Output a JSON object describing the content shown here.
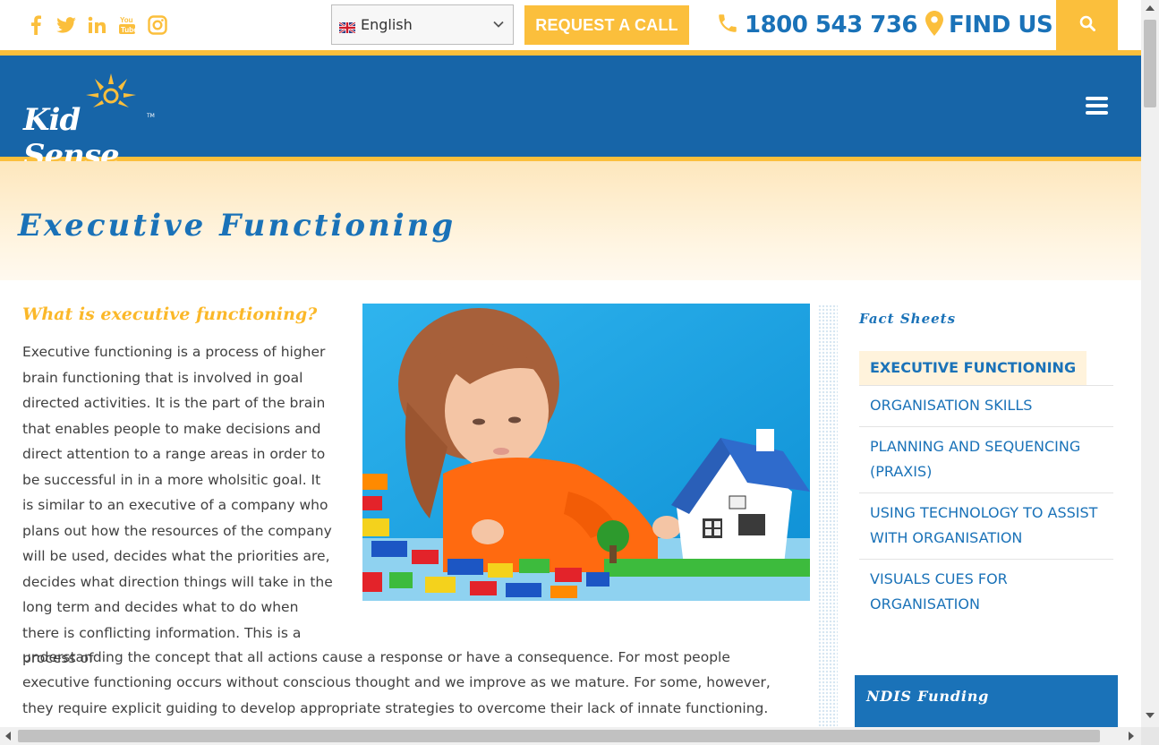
{
  "topbar": {
    "social_icons": [
      "facebook-icon",
      "twitter-icon",
      "linkedin-icon",
      "youtube-icon",
      "instagram-icon"
    ],
    "language": {
      "selected": "English",
      "flag": "uk-flag-icon"
    },
    "request_call_label": "REQUEST A CALL",
    "phone_label": "1800 543 736",
    "find_us_label": "FIND US"
  },
  "header": {
    "logo_text": "Kid Sense",
    "logo_tm": "TM"
  },
  "page": {
    "title": "Executive Functioning"
  },
  "content": {
    "heading": "What is executive functioning?",
    "paragraph_part1": "Executive functioning is a process of higher brain functioning that is involved in goal directed activities. It is the part of the brain that enables people to make decisions and direct attention to a range areas in order to be successful in in a  more wholsitic goal. It is similar to an executive of a company who plans out how the resources of the company will be used, decides what the priorities are, decides what direction things will take in the long term and decides what to do when there is conflicting information. This is a process of",
    "paragraph_part2": "understanding the concept that all actions cause a response or have a consequence. For most people executive functioning occurs without conscious thought and we improve as we mature. For some, however, they require explicit guiding to develop appropriate strategies to overcome their lack of innate functioning. Executive functioning deficits"
  },
  "sidebar": {
    "heading": "Fact Sheets",
    "items": [
      {
        "label": "EXECUTIVE FUNCTIONING",
        "active": true
      },
      {
        "label": "ORGANISATION SKILLS",
        "active": false
      },
      {
        "label": "PLANNING AND SEQUENCING (PRAXIS)",
        "active": false
      },
      {
        "label": "USING TECHNOLOGY TO ASSIST WITH ORGANISATION",
        "active": false
      },
      {
        "label": "VISUALS CUES FOR ORGANISATION",
        "active": false
      }
    ],
    "ndis_label": "NDIS Funding"
  },
  "colors": {
    "brand_blue": "#1765a8",
    "link_blue": "#1a72b8",
    "accent_yellow": "#fbbf3c",
    "active_bg": "#fff3dc"
  }
}
